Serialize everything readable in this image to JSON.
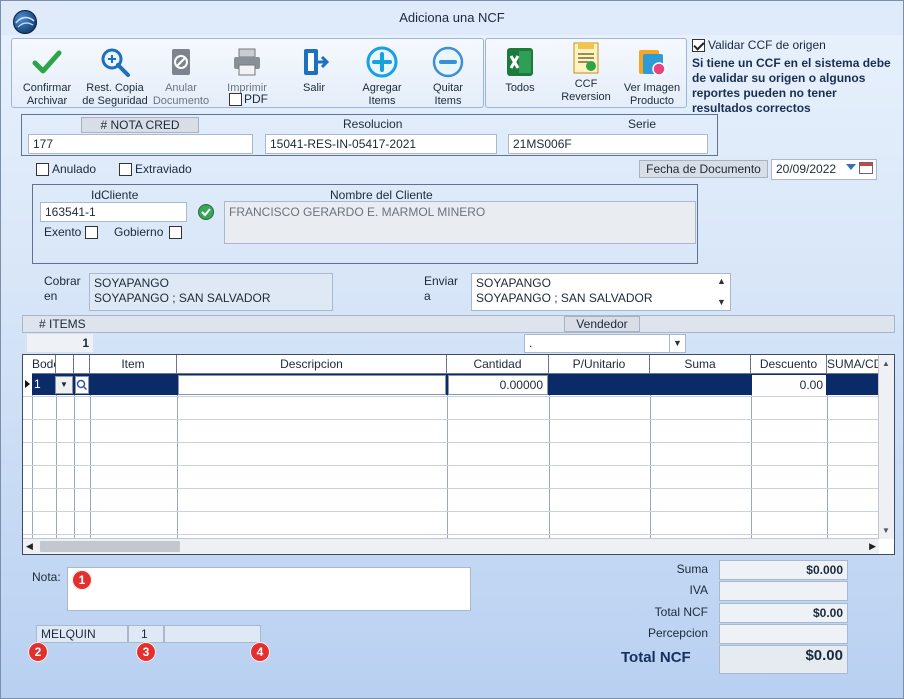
{
  "window": {
    "title": "Adiciona una NCF"
  },
  "toolbar": {
    "confirm": "Confirmar\nArchivar",
    "restore": "Rest. Copia\nde Seguridad",
    "cancel_doc": "Anular\nDocumento",
    "print": "Imprimir",
    "pdf": "PDF",
    "exit": "Salir",
    "add_items": "Agregar\nItems",
    "remove_items": "Quitar\nItems",
    "all": "Todos",
    "ccf_reversion": "CCF\nReversion",
    "view_image": "Ver Imagen\nProducto"
  },
  "validate": {
    "label": "Validar CCF de origen",
    "checked": true,
    "note": "Si tiene un CCF en el sistema debe de validar su origen o algunos reportes pueden no tener resultados correctos"
  },
  "header": {
    "nota_cred_label": "# NOTA CRED",
    "nota_cred_value": "177",
    "resolucion_label": "Resolucion",
    "resolucion_value": "15041-RES-IN-05417-2021",
    "serie_label": "Serie",
    "serie_value": "21MS006F"
  },
  "flags": {
    "anulado": "Anulado",
    "extraviado": "Extraviado"
  },
  "fecha": {
    "label": "Fecha de  Documento",
    "value": "20/09/2022"
  },
  "client": {
    "id_label": "IdCliente",
    "id_value": "163541-1",
    "name_label": "Nombre del Cliente",
    "name_value": "FRANCISCO GERARDO E. MARMOL MINERO",
    "exento": "Exento",
    "gobierno": "Gobierno"
  },
  "address": {
    "cobrar_label": "Cobrar\nen",
    "cobrar_line1": "SOYAPANGO",
    "cobrar_line2": "SOYAPANGO ; SAN SALVADOR",
    "enviar_label": "Enviar\na",
    "enviar_line1": "SOYAPANGO",
    "enviar_line2": "SOYAPANGO ; SAN SALVADOR"
  },
  "items_bar": {
    "items_label": "# ITEMS",
    "items_count": "1",
    "vendedor_label": "Vendedor",
    "vendedor_value": "."
  },
  "grid": {
    "columns": [
      "Bodega",
      "",
      "Item",
      "Descripcion",
      "Cantidad",
      "P/Unitario",
      "Suma",
      "Descuento",
      "SUMA/CD"
    ],
    "row": {
      "bodega": "1",
      "cantidad": "0.00000",
      "descuento": "0.00"
    }
  },
  "nota": {
    "label": "Nota:"
  },
  "footer": {
    "user": "MELQUIN",
    "num": "1",
    "extra": ""
  },
  "badges": [
    "1",
    "2",
    "3",
    "4"
  ],
  "totals": {
    "suma_label": "Suma",
    "suma_value": "$0.000",
    "iva_label": "IVA",
    "iva_value": "",
    "total_ncf_label": "Total NCF",
    "total_ncf_value": "$0.00",
    "percepcion_label": "Percepcion",
    "percepcion_value": "",
    "grand_label": "Total NCF",
    "grand_value": "$0.00"
  },
  "colors": {
    "accent": "#0b2b68",
    "badge": "#e3302f",
    "window_bg": "#d8e6f8"
  }
}
